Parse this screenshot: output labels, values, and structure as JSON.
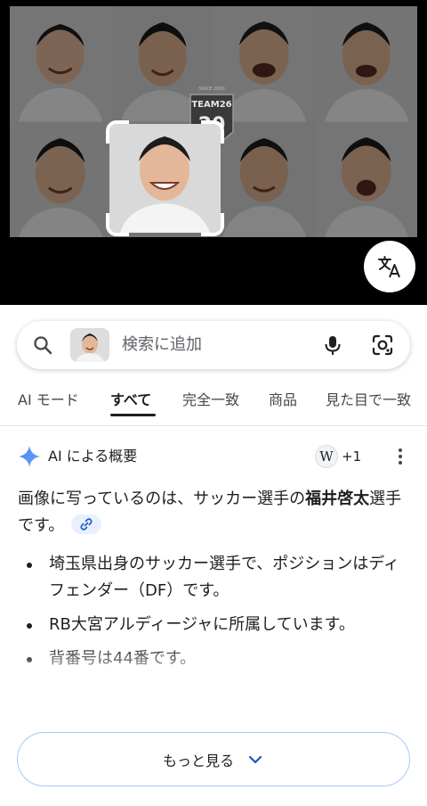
{
  "viewer": {
    "logo": {
      "top_text": "SINCE 2000",
      "main_text": "TEAM26",
      "number": "20",
      "suffix": "TH"
    }
  },
  "search": {
    "placeholder": "検索に追加"
  },
  "tabs": [
    {
      "label": "AI モード",
      "active": false
    },
    {
      "label": "すべて",
      "active": true
    },
    {
      "label": "完全一致",
      "active": false
    },
    {
      "label": "商品",
      "active": false
    },
    {
      "label": "見た目で一致",
      "active": false
    }
  ],
  "ai_overview": {
    "title": "AI による概要",
    "source_icon_letter": "W",
    "source_count": "+1",
    "summary_prefix": "画像に写っているのは、サッカー選手の",
    "summary_name": "福井啓太",
    "summary_suffix": "選手です。",
    "bullets": [
      "埼玉県出身のサッカー選手で、ポジションはディフェンダー（DF）です。",
      "RB大宮アルディージャに所属しています。",
      "背番号は44番です。"
    ]
  },
  "more_button": {
    "label": "もっと見る"
  },
  "colors": {
    "accent_blue": "#4285f4",
    "chip_bg": "#e8f0fe",
    "button_border": "#a8c7fa"
  }
}
